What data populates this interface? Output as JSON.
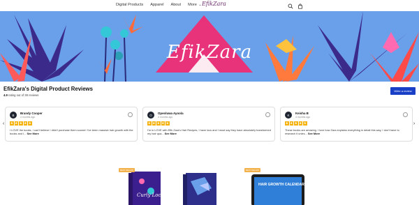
{
  "nav": {
    "links": [
      "Digital Products",
      "Apparel",
      "About",
      "More"
    ],
    "more_chevron": "⌄",
    "logo_text": "EfikZara",
    "icons": [
      "search-icon",
      "cart-icon"
    ]
  },
  "hero": {
    "title": "EfikZara",
    "colors": {
      "sky": "#6aa0ea",
      "triangle": "#e8327a",
      "leaves": "#3c2a8a",
      "flowers": "#ff6a3a",
      "teal": "#34c7d8"
    }
  },
  "reviews": {
    "title": "EfikZara's Digital Product Reviews",
    "rating_value": "4.9",
    "rating_text": "rating out of 38 reviews",
    "write_button": "Write a review",
    "cards": [
      {
        "initial": "B",
        "name": "Brandy Cooper",
        "time": "4 months ago",
        "text": "I LOVE the books, I can't believe I didn't purchase them sooner! I've been massive hair growth with the books and I...",
        "see_more": "See More"
      },
      {
        "initial": "O",
        "name": "Opeoluwa Ayoola",
        "time": "4 months ago",
        "text": "I'm in LOVE with Efik Zara's Hair Recipes, I have locs and I must say they have absolutely transformed my hair qua...",
        "see_more": "See More"
      },
      {
        "initial": "K",
        "name": "Keisha B",
        "time": "4 months ago",
        "text": "These books are amazing. I love how Zara explains everything in detail this way, I don't have to research it unles...",
        "see_more": "See More"
      }
    ],
    "stars_per_card": 5,
    "arrow_left": "‹",
    "arrow_right": "›"
  },
  "products": {
    "badges": [
      "BEST SELLER",
      "BEST SELLER"
    ],
    "items": [
      {
        "cover_text": "Curly Locks"
      },
      {
        "cover_text": ""
      },
      {
        "cover_text": "HAIR GROWTH CALENDAR"
      }
    ]
  }
}
